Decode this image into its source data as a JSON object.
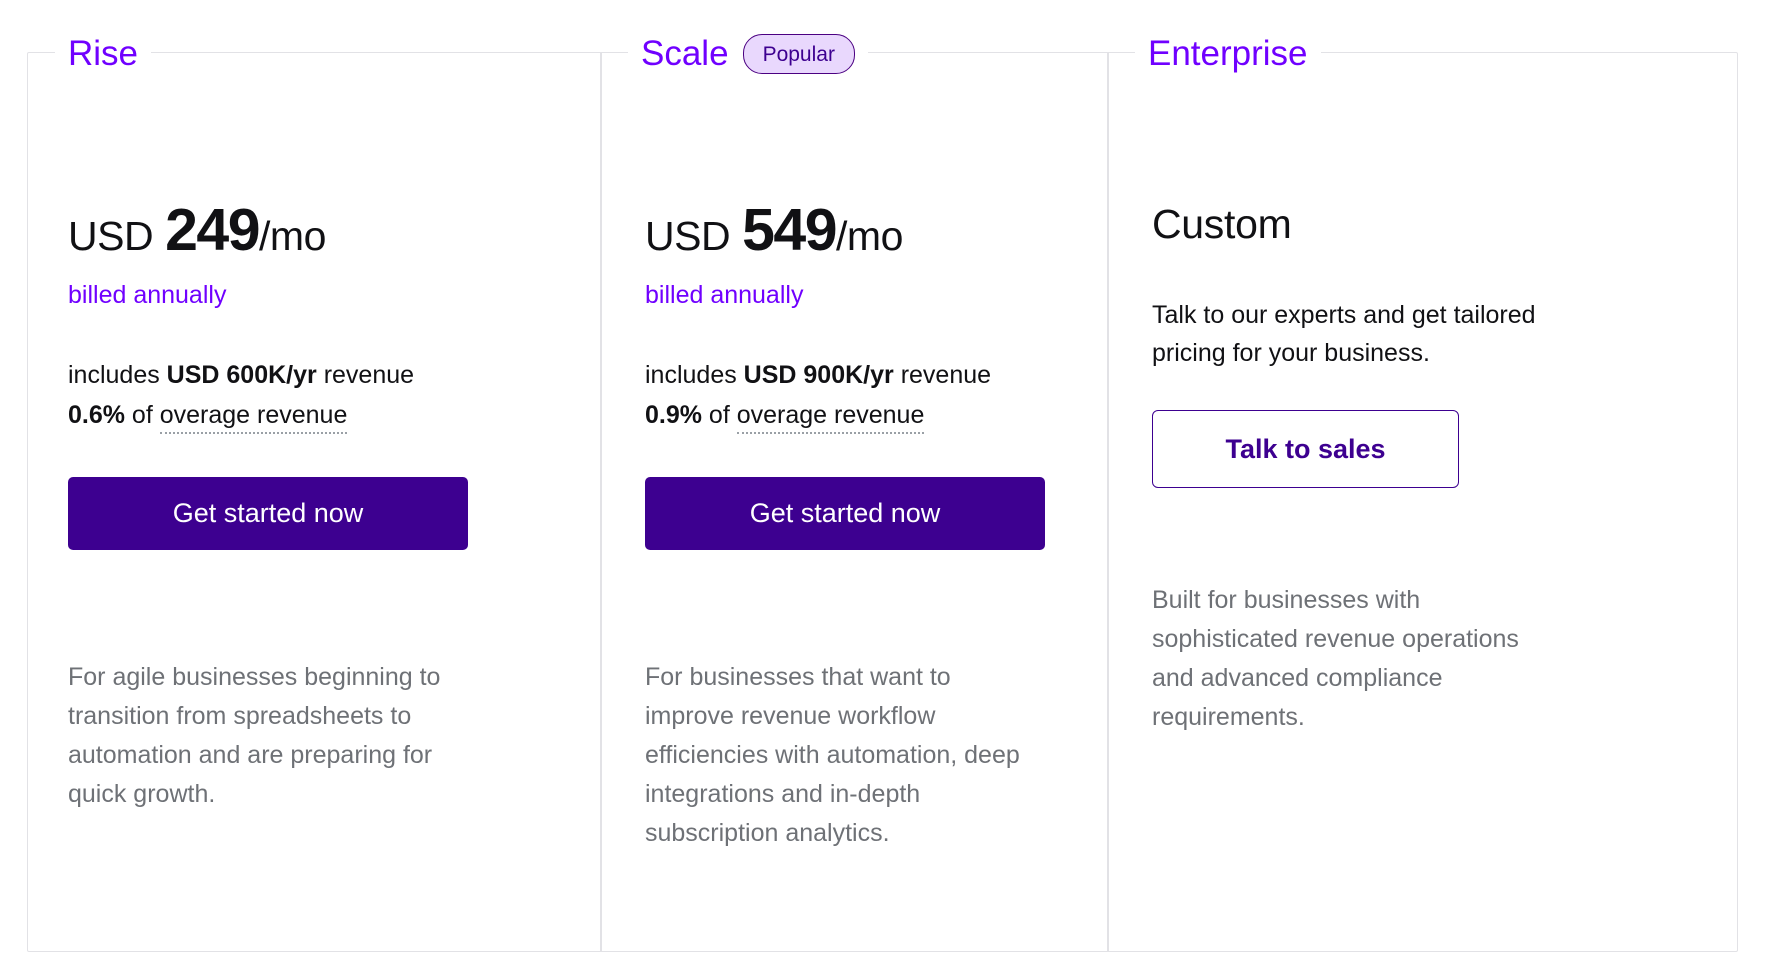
{
  "card": {
    "border_color": "#e2e2e6",
    "accent_purple": "#7000ff",
    "deep_purple": "#3d0090",
    "badge_bg": "#e9d8fd"
  },
  "plans": [
    {
      "name": "Rise",
      "badge": null,
      "price": {
        "currency": "USD",
        "amount": "249",
        "period": "/mo"
      },
      "billing_note": "billed annually",
      "includes": {
        "prefix": "includes ",
        "revenue": "USD 600K/yr",
        "suffix": " revenue"
      },
      "overage": {
        "percent": "0.6%",
        "middle": " of ",
        "term": "overage revenue"
      },
      "cta": "Get started now",
      "description": "For agile businesses beginning to transition from spreadsheets to automation and are preparing for quick growth."
    },
    {
      "name": "Scale",
      "badge": "Popular",
      "price": {
        "currency": "USD",
        "amount": "549",
        "period": "/mo"
      },
      "billing_note": "billed annually",
      "includes": {
        "prefix": "includes ",
        "revenue": "USD 900K/yr",
        "suffix": " revenue"
      },
      "overage": {
        "percent": "0.9%",
        "middle": " of ",
        "term": "overage revenue"
      },
      "cta": "Get started now",
      "description": "For businesses that want to improve revenue workflow efficiencies with automation, deep integrations and in-depth subscription analytics."
    },
    {
      "name": "Enterprise",
      "badge": null,
      "price_custom": "Custom",
      "contact_copy": "Talk to our experts and get tailored pricing for your business.",
      "cta": "Talk to sales",
      "description": "Built for businesses with sophisticated revenue operations and advanced compliance requirements."
    }
  ]
}
